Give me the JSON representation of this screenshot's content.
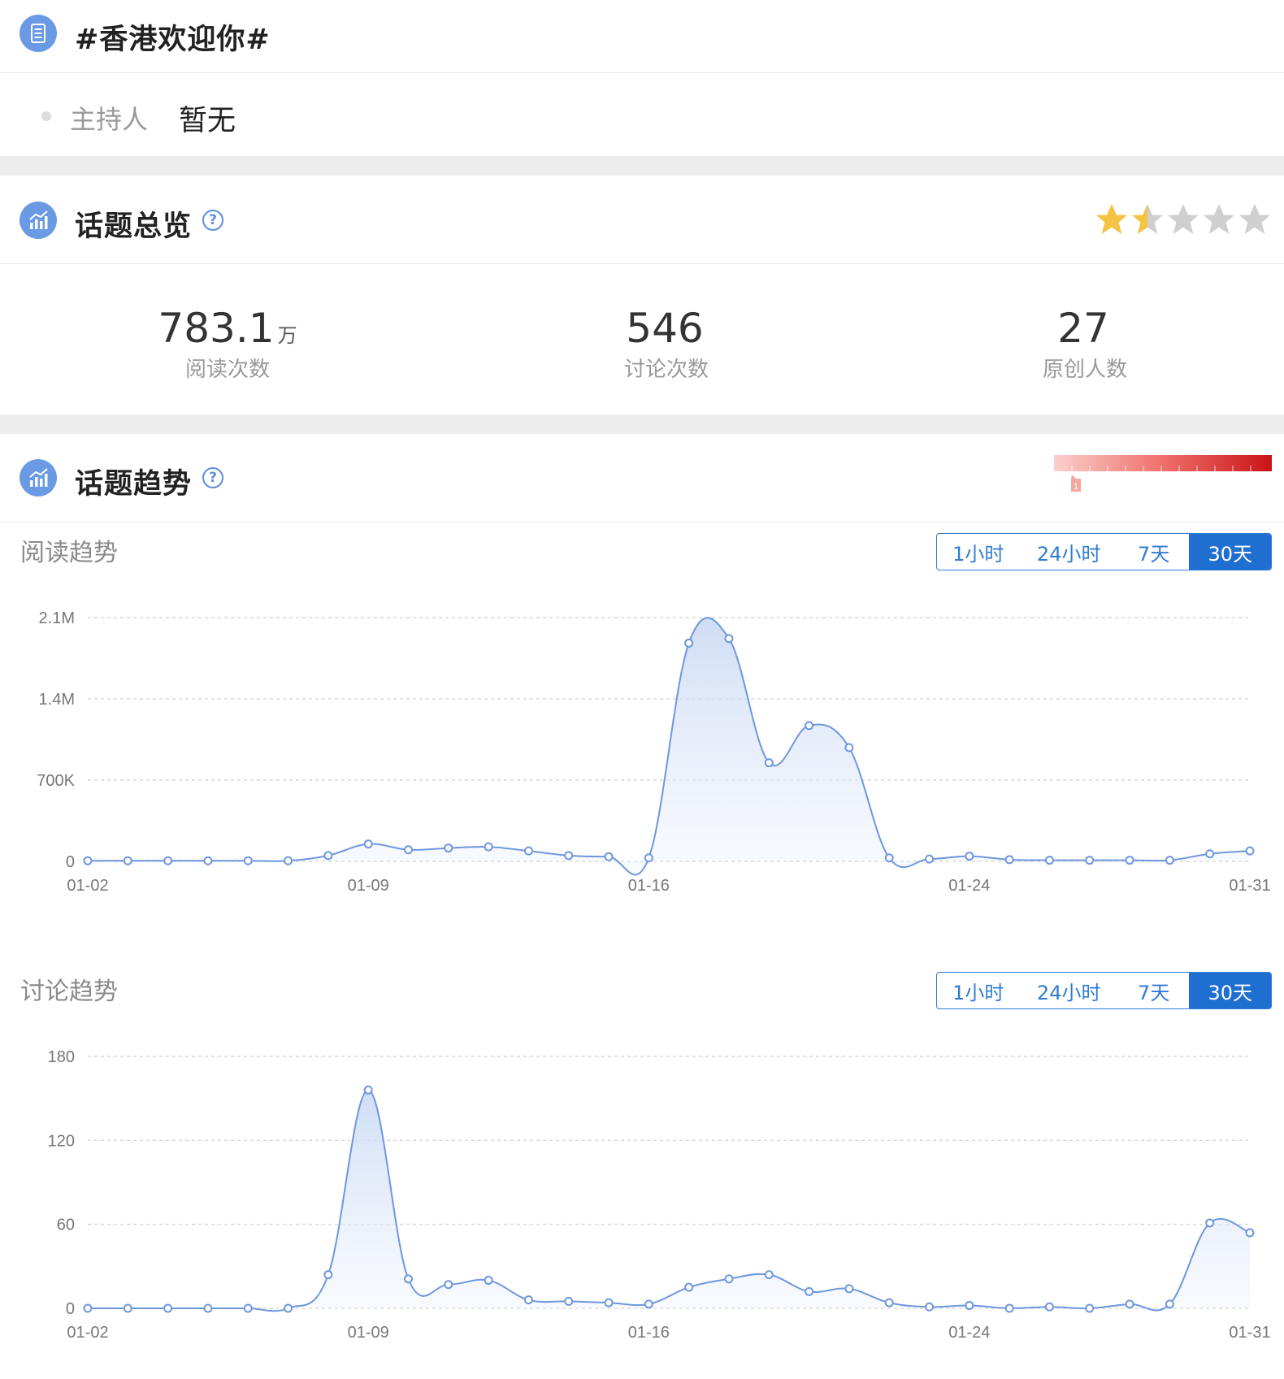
{
  "topic": {
    "title": "#香港欢迎你#"
  },
  "host": {
    "label": "主持人",
    "value": "暂无"
  },
  "overview": {
    "title": "话题总览",
    "help_icon": "?",
    "rating_stars": 1.5,
    "rating_max": 5,
    "stats": [
      {
        "value": "783.1",
        "unit": "万",
        "label": "阅读次数"
      },
      {
        "value": "546",
        "unit": "",
        "label": "讨论次数"
      },
      {
        "value": "27",
        "unit": "",
        "label": "原创人数"
      }
    ]
  },
  "trend": {
    "title": "话题趋势",
    "help_icon": "?",
    "heat_level": "1"
  },
  "time_ranges": [
    "1小时",
    "24小时",
    "7天",
    "30天"
  ],
  "active_range": "30天",
  "colors": {
    "accent": "#1f6fd1",
    "line": "#6d97de",
    "star": "#f5c242",
    "star_off": "#cfcfcf"
  },
  "chart_data": [
    {
      "type": "area",
      "title": "阅读趋势",
      "x": [
        "01-02",
        "01-03",
        "01-04",
        "01-05",
        "01-06",
        "01-07",
        "01-08",
        "01-09",
        "01-10",
        "01-11",
        "01-12",
        "01-13",
        "01-14",
        "01-15",
        "01-16",
        "01-17",
        "01-18",
        "01-19",
        "01-20",
        "01-21",
        "01-22",
        "01-23",
        "01-24",
        "01-25",
        "01-26",
        "01-27",
        "01-28",
        "01-29",
        "01-30",
        "01-31"
      ],
      "x_ticks": [
        "01-02",
        "01-09",
        "01-16",
        "01-24",
        "01-31"
      ],
      "y_ticks": [
        "0",
        "700K",
        "1.4M",
        "2.1M"
      ],
      "ylim": [
        0,
        2100000
      ],
      "values": [
        5000,
        5000,
        5000,
        5000,
        5000,
        5000,
        50000,
        150000,
        100000,
        115000,
        125000,
        90000,
        50000,
        40000,
        30000,
        1880000,
        1920000,
        850000,
        1170000,
        980000,
        30000,
        20000,
        45000,
        15000,
        10000,
        10000,
        10000,
        10000,
        65000,
        90000
      ],
      "grid": true
    },
    {
      "type": "area",
      "title": "讨论趋势",
      "x": [
        "01-02",
        "01-03",
        "01-04",
        "01-05",
        "01-06",
        "01-07",
        "01-08",
        "01-09",
        "01-10",
        "01-11",
        "01-12",
        "01-13",
        "01-14",
        "01-15",
        "01-16",
        "01-17",
        "01-18",
        "01-19",
        "01-20",
        "01-21",
        "01-22",
        "01-23",
        "01-24",
        "01-25",
        "01-26",
        "01-27",
        "01-28",
        "01-29",
        "01-30",
        "01-31"
      ],
      "x_ticks": [
        "01-02",
        "01-09",
        "01-16",
        "01-24",
        "01-31"
      ],
      "y_ticks": [
        "0",
        "60",
        "120",
        "180"
      ],
      "ylim": [
        0,
        180
      ],
      "values": [
        0,
        0,
        0,
        0,
        0,
        0,
        24,
        156,
        21,
        17,
        20,
        6,
        5,
        4,
        3,
        15,
        21,
        24,
        12,
        14,
        4,
        1,
        2,
        0,
        1,
        0,
        3,
        3,
        61,
        54
      ],
      "grid": true
    }
  ]
}
